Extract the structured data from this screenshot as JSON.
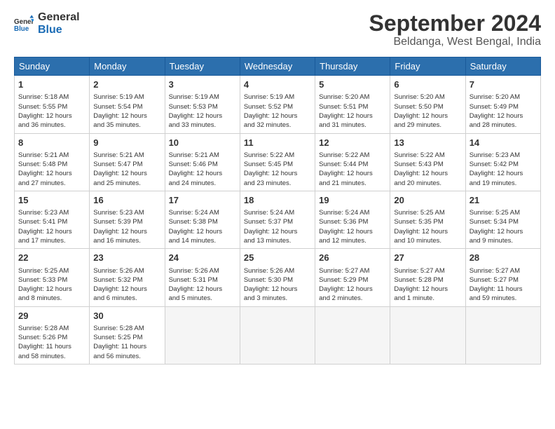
{
  "logo": {
    "text_general": "General",
    "text_blue": "Blue"
  },
  "header": {
    "title": "September 2024",
    "subtitle": "Beldanga, West Bengal, India"
  },
  "weekdays": [
    "Sunday",
    "Monday",
    "Tuesday",
    "Wednesday",
    "Thursday",
    "Friday",
    "Saturday"
  ],
  "weeks": [
    [
      {
        "day": "1",
        "info": "Sunrise: 5:18 AM\nSunset: 5:55 PM\nDaylight: 12 hours\nand 36 minutes."
      },
      {
        "day": "2",
        "info": "Sunrise: 5:19 AM\nSunset: 5:54 PM\nDaylight: 12 hours\nand 35 minutes."
      },
      {
        "day": "3",
        "info": "Sunrise: 5:19 AM\nSunset: 5:53 PM\nDaylight: 12 hours\nand 33 minutes."
      },
      {
        "day": "4",
        "info": "Sunrise: 5:19 AM\nSunset: 5:52 PM\nDaylight: 12 hours\nand 32 minutes."
      },
      {
        "day": "5",
        "info": "Sunrise: 5:20 AM\nSunset: 5:51 PM\nDaylight: 12 hours\nand 31 minutes."
      },
      {
        "day": "6",
        "info": "Sunrise: 5:20 AM\nSunset: 5:50 PM\nDaylight: 12 hours\nand 29 minutes."
      },
      {
        "day": "7",
        "info": "Sunrise: 5:20 AM\nSunset: 5:49 PM\nDaylight: 12 hours\nand 28 minutes."
      }
    ],
    [
      {
        "day": "8",
        "info": "Sunrise: 5:21 AM\nSunset: 5:48 PM\nDaylight: 12 hours\nand 27 minutes."
      },
      {
        "day": "9",
        "info": "Sunrise: 5:21 AM\nSunset: 5:47 PM\nDaylight: 12 hours\nand 25 minutes."
      },
      {
        "day": "10",
        "info": "Sunrise: 5:21 AM\nSunset: 5:46 PM\nDaylight: 12 hours\nand 24 minutes."
      },
      {
        "day": "11",
        "info": "Sunrise: 5:22 AM\nSunset: 5:45 PM\nDaylight: 12 hours\nand 23 minutes."
      },
      {
        "day": "12",
        "info": "Sunrise: 5:22 AM\nSunset: 5:44 PM\nDaylight: 12 hours\nand 21 minutes."
      },
      {
        "day": "13",
        "info": "Sunrise: 5:22 AM\nSunset: 5:43 PM\nDaylight: 12 hours\nand 20 minutes."
      },
      {
        "day": "14",
        "info": "Sunrise: 5:23 AM\nSunset: 5:42 PM\nDaylight: 12 hours\nand 19 minutes."
      }
    ],
    [
      {
        "day": "15",
        "info": "Sunrise: 5:23 AM\nSunset: 5:41 PM\nDaylight: 12 hours\nand 17 minutes."
      },
      {
        "day": "16",
        "info": "Sunrise: 5:23 AM\nSunset: 5:39 PM\nDaylight: 12 hours\nand 16 minutes."
      },
      {
        "day": "17",
        "info": "Sunrise: 5:24 AM\nSunset: 5:38 PM\nDaylight: 12 hours\nand 14 minutes."
      },
      {
        "day": "18",
        "info": "Sunrise: 5:24 AM\nSunset: 5:37 PM\nDaylight: 12 hours\nand 13 minutes."
      },
      {
        "day": "19",
        "info": "Sunrise: 5:24 AM\nSunset: 5:36 PM\nDaylight: 12 hours\nand 12 minutes."
      },
      {
        "day": "20",
        "info": "Sunrise: 5:25 AM\nSunset: 5:35 PM\nDaylight: 12 hours\nand 10 minutes."
      },
      {
        "day": "21",
        "info": "Sunrise: 5:25 AM\nSunset: 5:34 PM\nDaylight: 12 hours\nand 9 minutes."
      }
    ],
    [
      {
        "day": "22",
        "info": "Sunrise: 5:25 AM\nSunset: 5:33 PM\nDaylight: 12 hours\nand 8 minutes."
      },
      {
        "day": "23",
        "info": "Sunrise: 5:26 AM\nSunset: 5:32 PM\nDaylight: 12 hours\nand 6 minutes."
      },
      {
        "day": "24",
        "info": "Sunrise: 5:26 AM\nSunset: 5:31 PM\nDaylight: 12 hours\nand 5 minutes."
      },
      {
        "day": "25",
        "info": "Sunrise: 5:26 AM\nSunset: 5:30 PM\nDaylight: 12 hours\nand 3 minutes."
      },
      {
        "day": "26",
        "info": "Sunrise: 5:27 AM\nSunset: 5:29 PM\nDaylight: 12 hours\nand 2 minutes."
      },
      {
        "day": "27",
        "info": "Sunrise: 5:27 AM\nSunset: 5:28 PM\nDaylight: 12 hours\nand 1 minute."
      },
      {
        "day": "28",
        "info": "Sunrise: 5:27 AM\nSunset: 5:27 PM\nDaylight: 11 hours\nand 59 minutes."
      }
    ],
    [
      {
        "day": "29",
        "info": "Sunrise: 5:28 AM\nSunset: 5:26 PM\nDaylight: 11 hours\nand 58 minutes."
      },
      {
        "day": "30",
        "info": "Sunrise: 5:28 AM\nSunset: 5:25 PM\nDaylight: 11 hours\nand 56 minutes."
      },
      {
        "day": "",
        "info": ""
      },
      {
        "day": "",
        "info": ""
      },
      {
        "day": "",
        "info": ""
      },
      {
        "day": "",
        "info": ""
      },
      {
        "day": "",
        "info": ""
      }
    ]
  ]
}
